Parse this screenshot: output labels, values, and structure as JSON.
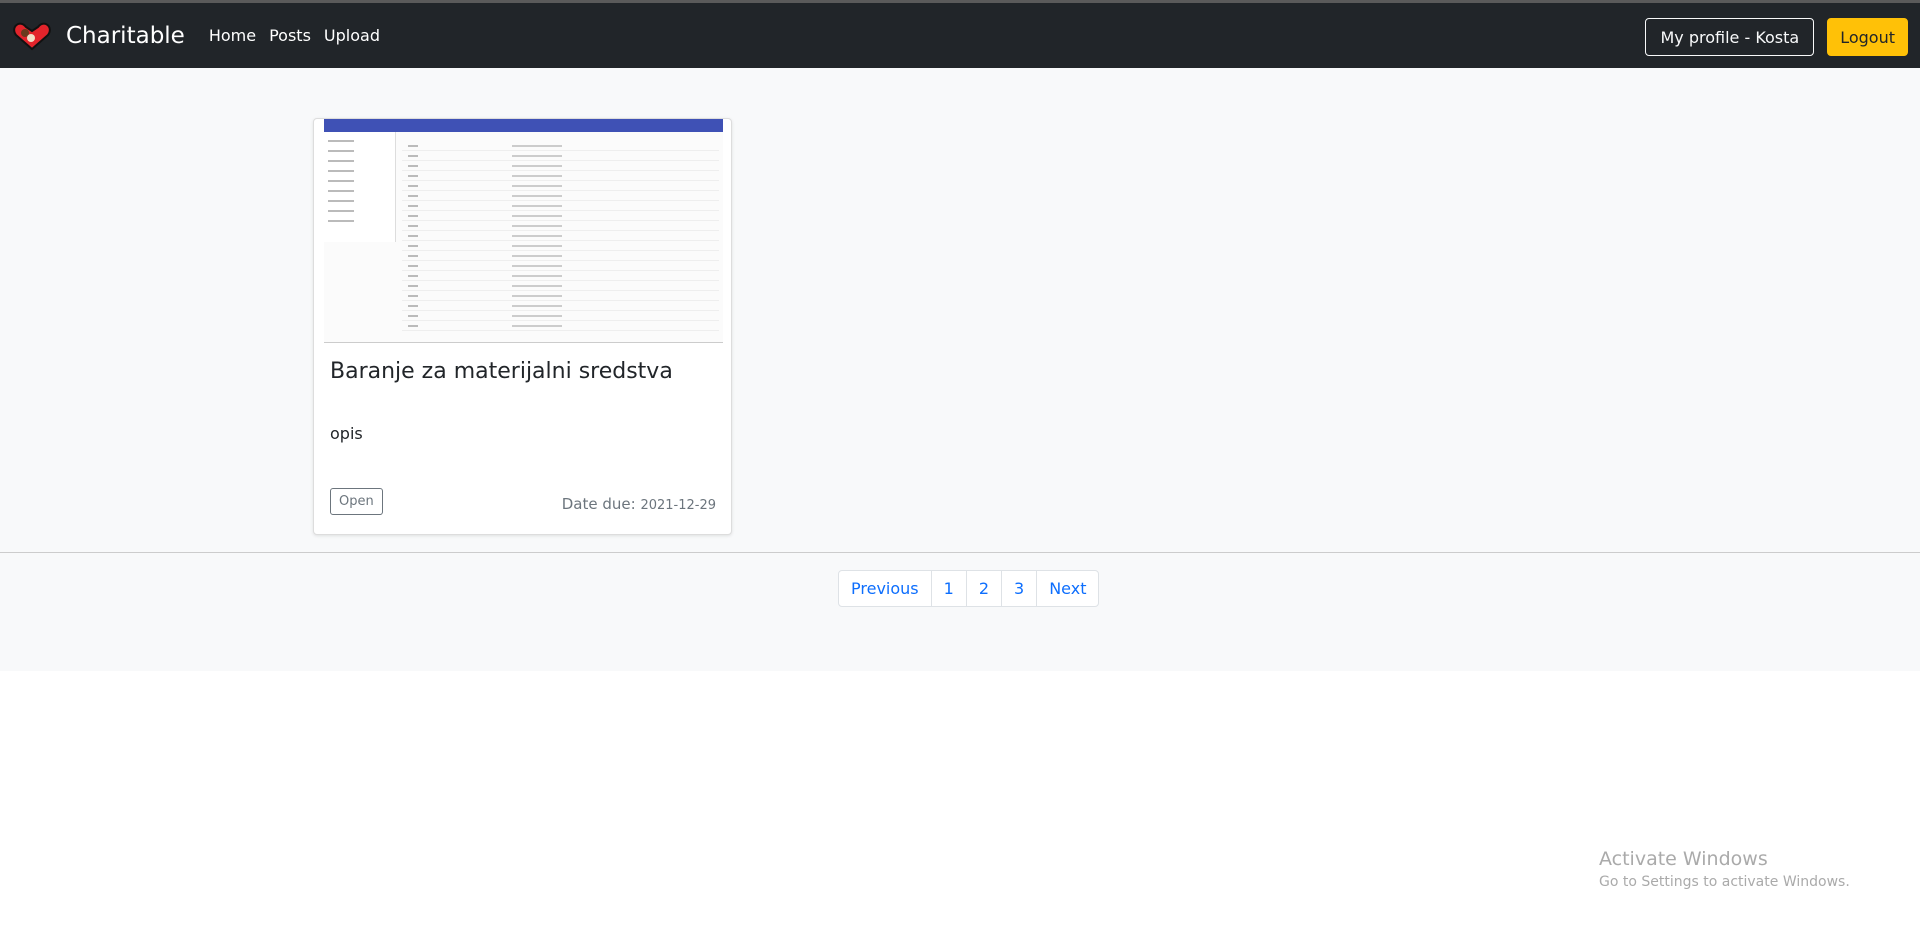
{
  "navbar": {
    "brand": "Charitable",
    "links": [
      "Home",
      "Posts",
      "Upload"
    ],
    "profile_label": "My profile - Kosta",
    "logout_label": "Logout"
  },
  "post": {
    "title": "Baranje za materijalni sredstva",
    "description": "opis",
    "status": "Open",
    "due_label": "Date due:",
    "due_date": "2021-12-29"
  },
  "pagination": {
    "previous": "Previous",
    "pages": [
      "1",
      "2",
      "3"
    ],
    "next": "Next"
  },
  "watermark": {
    "title": "Activate Windows",
    "subtitle": "Go to Settings to activate Windows."
  },
  "colors": {
    "navbar": "#212529",
    "accent": "#ffc107",
    "link": "#0d6efd"
  }
}
